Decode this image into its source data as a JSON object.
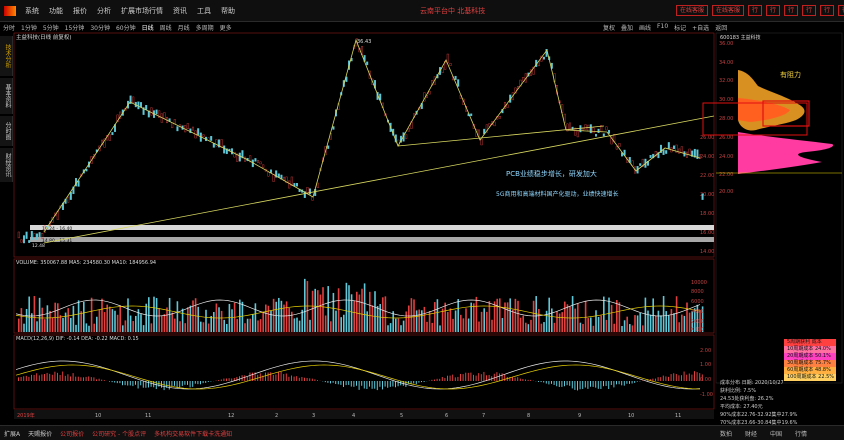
{
  "menu": {
    "items": [
      "系统",
      "功能",
      "报价",
      "分析",
      "扩展市场行情",
      "资讯",
      "工具",
      "帮助"
    ],
    "center": "云南平台中 北基科技",
    "buttons": [
      "在线客服",
      "在线客服",
      "行",
      "行",
      "行",
      "行",
      "行",
      "行"
    ]
  },
  "toolbar": {
    "periods": [
      "分时",
      "1分钟",
      "5分钟",
      "15分钟",
      "30分钟",
      "60分钟",
      "日线",
      "周线",
      "月线",
      "多周期",
      "更多"
    ],
    "active": "日线",
    "tools": [
      "复权",
      "叠加",
      "画线",
      "F10",
      "标记",
      "+自选",
      "返回"
    ]
  },
  "sidetabs": [
    "技术分析",
    "基本资料",
    "分时图",
    "财经资讯"
  ],
  "main": {
    "title": "主益科技(日线 前复权)",
    "axis": [
      "26.00",
      "24.00",
      "22.00",
      "20.00",
      "18.00",
      "16.00",
      "14.00"
    ],
    "peak_label": "36.43",
    "low_label": "12.48",
    "range1": "16.24 - 16.40",
    "range2": "14.80 - 15.31",
    "annotation1": "PCB业绩稳步增长，研发加大",
    "annotation2": "5G商用和高端材料国产化驱动，业绩快速增长",
    "resistance": "有阻力"
  },
  "volume": {
    "title": "VOLUME: 350067.88  MA5: 234580.30  MA10: 184956.94",
    "axis": [
      "10000",
      "8000",
      "6000",
      "4000",
      "2000"
    ],
    "unit": "X100"
  },
  "macd": {
    "title": "MACD(12,26,9)  DIF: -0.14  DEA: -0.22  MACD: 0.15",
    "axis": [
      "2.00",
      "1.00",
      "0.00",
      "-1.00"
    ]
  },
  "dates": [
    "2019年",
    "10",
    "11",
    "12",
    "2",
    "3",
    "4",
    "5",
    "6",
    "7",
    "8",
    "9",
    "10",
    "11"
  ],
  "chips": {
    "title": "600183 主益科技",
    "axis": [
      "36.00",
      "34.00",
      "32.00",
      "30.00",
      "28.00",
      "26.00",
      "24.00",
      "22.00",
      "20.00"
    ],
    "legend": [
      {
        "label": "5周期获利 成本",
        "color": "#ff4040"
      },
      {
        "label": "10周期成本 24.0%",
        "color": "#ff70a0"
      },
      {
        "label": "20周期成本 50.1%",
        "color": "#ff40c0"
      },
      {
        "label": "30周期成本 75.7%",
        "color": "#ff8040"
      },
      {
        "label": "60周期成本 48.8%",
        "color": "#ffb040"
      },
      {
        "label": "100周期成本 22.5%",
        "color": "#ffd060"
      }
    ],
    "stats": [
      "成本分布 日期: 2020/10/27",
      "获利比例: 7.5%",
      "24.53处获利盘: 26.2%",
      "平均成本: 27.40元",
      "90%成本22.76-32.92集中27.9%",
      "70%成本23.66-30.84集中19.6%"
    ]
  },
  "status": {
    "items": [
      "扩展A",
      "天赐报价",
      "公司报价",
      "公司研究 - 个股点评",
      "多机构交易软件下载卡洗通知"
    ],
    "right": [
      "数拍",
      "财经",
      "中国",
      "行情"
    ]
  }
}
